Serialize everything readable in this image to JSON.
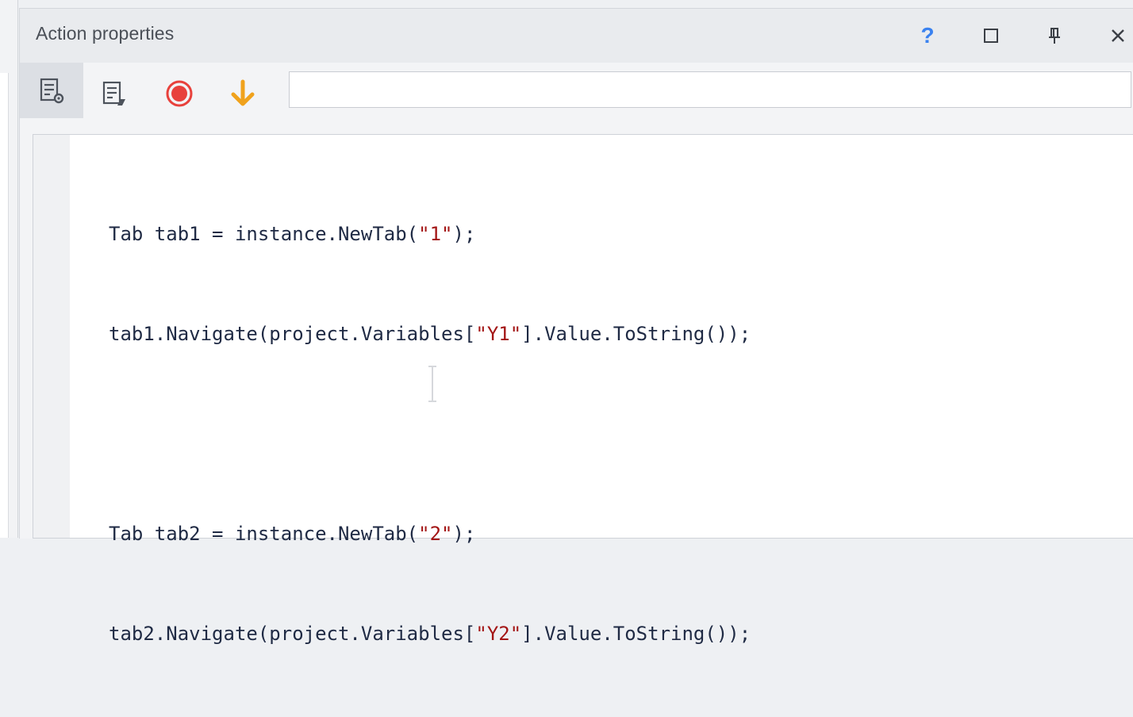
{
  "window": {
    "title": "Action properties",
    "buttons": {
      "help": "?",
      "maximize_icon": "maximize-icon",
      "pin_icon": "pin-icon",
      "close_icon": "close-icon"
    }
  },
  "toolbar": {
    "tools": [
      {
        "icon": "action-properties-icon",
        "active": true
      },
      {
        "icon": "script-edit-icon",
        "active": false
      },
      {
        "icon": "record-icon",
        "color": "#e8413c"
      },
      {
        "icon": "arrow-down-icon",
        "color": "#f0a21c"
      }
    ],
    "search_value": "",
    "search_placeholder": ""
  },
  "editor": {
    "lines": [
      {
        "before": "Tab tab1 = instance.NewTab(",
        "string": "\"1\"",
        "after": ");"
      },
      {
        "before": "tab1.Navigate(project.Variables[",
        "string": "\"Y1\"",
        "after": "].Value.ToString());"
      },
      {
        "before": "",
        "string": "",
        "after": ""
      },
      {
        "before": "Tab tab2 = instance.NewTab(",
        "string": "\"2\"",
        "after": ");"
      },
      {
        "before": "tab2.Navigate(project.Variables[",
        "string": "\"Y2\"",
        "after": "].Value.ToString());"
      }
    ]
  },
  "colors": {
    "accent": "#3a82f0",
    "string": "#a31515",
    "code": "#1f2a44"
  }
}
